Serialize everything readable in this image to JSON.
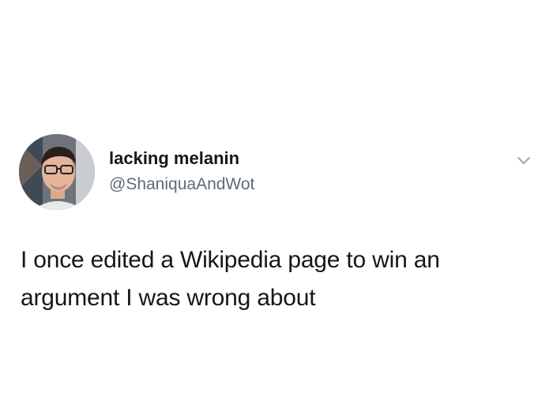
{
  "tweet": {
    "display_name": "lacking melanin",
    "handle": "@ShaniquaAndWot",
    "text": "I once edited a Wikipedia page to win an argument I was wrong about",
    "more_icon": "chevron-down-icon"
  },
  "colors": {
    "background": "#ffffff",
    "name": "#14171a",
    "handle": "#5f6b77",
    "caret": "#9aa6b2"
  }
}
